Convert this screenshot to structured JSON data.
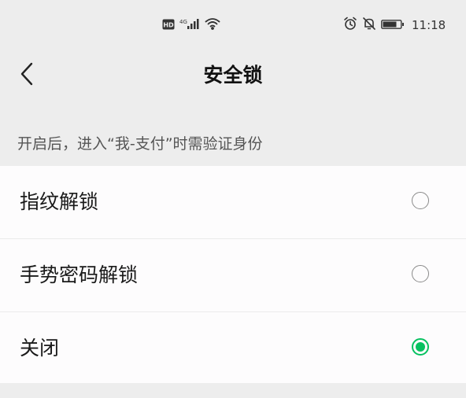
{
  "status_bar": {
    "time": "11:18",
    "network_label": "4G",
    "icons": [
      "hd-icon",
      "signal-icon",
      "wifi-icon",
      "alarm-icon",
      "mute-icon",
      "battery-icon"
    ]
  },
  "nav": {
    "title": "安全锁",
    "back_icon": "chevron-left-icon"
  },
  "hint": "开启后，进入“我-支付”时需验证身份",
  "options": [
    {
      "label": "指纹解锁",
      "selected": false
    },
    {
      "label": "手势密码解锁",
      "selected": false
    },
    {
      "label": "关闭",
      "selected": true
    }
  ],
  "colors": {
    "accent": "#07c160",
    "background": "#ededed",
    "card": "#fdfcfd"
  }
}
